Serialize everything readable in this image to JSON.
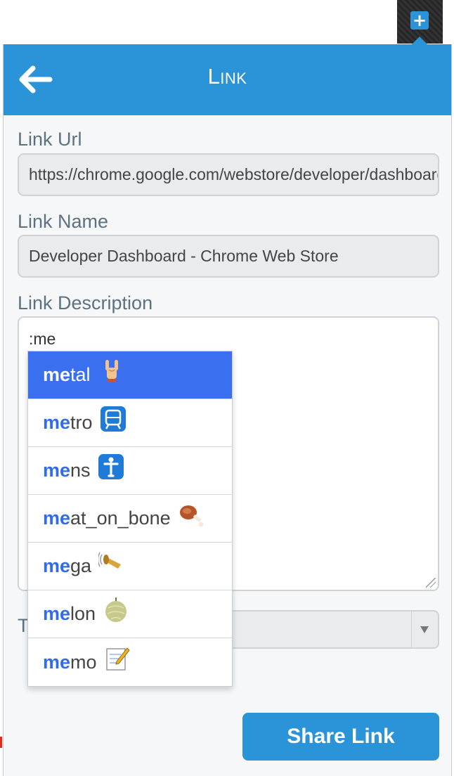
{
  "popup": {
    "title": "Link",
    "back_icon": "arrow-left-icon"
  },
  "extension": {
    "icon": "plus-icon",
    "symbol": "+"
  },
  "form": {
    "link_url": {
      "label": "Link Url",
      "value": "https://chrome.google.com/webstore/developer/dashboard"
    },
    "link_name": {
      "label": "Link Name",
      "value": "Developer Dashboard - Chrome Web Store"
    },
    "link_description": {
      "label": "Link Description",
      "value": ":me"
    },
    "partial_label": "T",
    "share_button": "Share Link"
  },
  "autocomplete": {
    "query": "me",
    "items": [
      {
        "match": "me",
        "rest": "tal",
        "icon": "metal-hand-icon",
        "selected": true
      },
      {
        "match": "me",
        "rest": "tro",
        "icon": "metro-icon",
        "selected": false
      },
      {
        "match": "me",
        "rest": "ns",
        "icon": "mens-icon",
        "selected": false
      },
      {
        "match": "me",
        "rest": "at_on_bone",
        "icon": "meat-on-bone-icon",
        "selected": false
      },
      {
        "match": "me",
        "rest": "ga",
        "icon": "mega-icon",
        "selected": false
      },
      {
        "match": "me",
        "rest": "lon",
        "icon": "melon-icon",
        "selected": false
      },
      {
        "match": "me",
        "rest": "mo",
        "icon": "memo-icon",
        "selected": false
      }
    ]
  },
  "colors": {
    "accent": "#2b93d7",
    "selected_row": "#3a6ff0",
    "match_text": "#2f6bea",
    "label_text": "#5d7281"
  }
}
